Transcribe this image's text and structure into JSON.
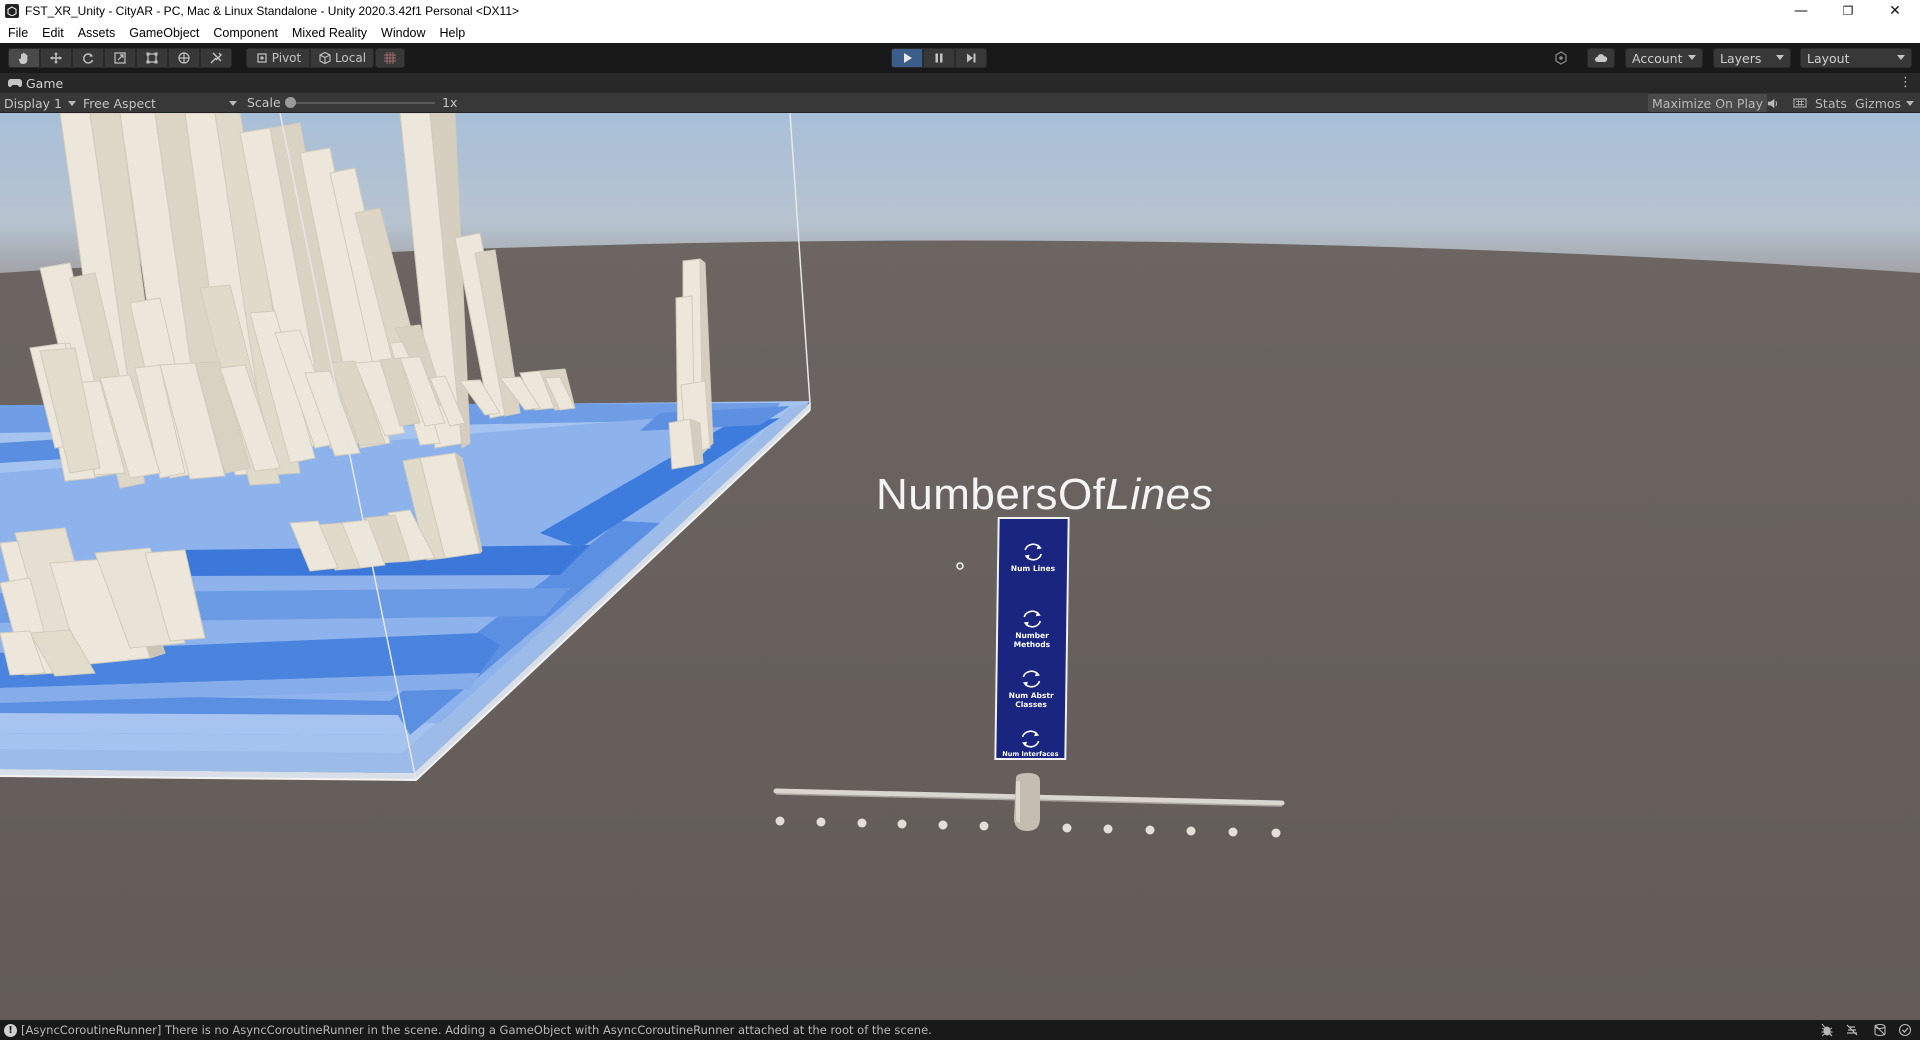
{
  "window": {
    "title": "FST_XR_Unity - CityAR - PC, Mac & Linux Standalone - Unity 2020.3.42f1 Personal <DX11>",
    "minimize_glyph": "—",
    "restore_glyph": "❐",
    "close_glyph": "✕"
  },
  "menu": [
    "File",
    "Edit",
    "Assets",
    "GameObject",
    "Component",
    "Mixed Reality",
    "Window",
    "Help"
  ],
  "toolbar": {
    "tools": [
      "hand-tool",
      "move-tool",
      "rotate-tool",
      "scale-tool",
      "rect-tool",
      "transform-tool",
      "custom-tool"
    ],
    "pivot_label": "Pivot",
    "local_label": "Local",
    "account_label": "Account",
    "layers_label": "Layers",
    "layout_label": "Layout",
    "play_active": true
  },
  "game_tab": {
    "label": "Game",
    "display": "Display 1",
    "aspect": "Free Aspect",
    "scale_label": "Scale",
    "scale_value": "1x",
    "maximize_label": "Maximize On Play",
    "stats_label": "Stats",
    "gizmos_label": "Gizmos"
  },
  "scene": {
    "title_part1": "NumbersOf",
    "title_part2": "Lines",
    "metric_buttons": [
      {
        "line1": "Num Lines",
        "line2": ""
      },
      {
        "line1": "Number",
        "line2": "Methods"
      },
      {
        "line1": "Num Abstr",
        "line2": "Classes"
      },
      {
        "line1": "Num Interfaces",
        "line2": ""
      }
    ],
    "colors": {
      "floor": "#655e5b",
      "sky_top": "#9fb6cf",
      "platform": "#8fb3ec",
      "district": "#4f86e0",
      "building": "#ece7da",
      "panel": "#1a2580"
    }
  },
  "status": {
    "message": "[AsyncCoroutineRunner] There is no AsyncCoroutineRunner in the scene. Adding a GameObject with AsyncCoroutineRunner attached at the root of the scene."
  }
}
